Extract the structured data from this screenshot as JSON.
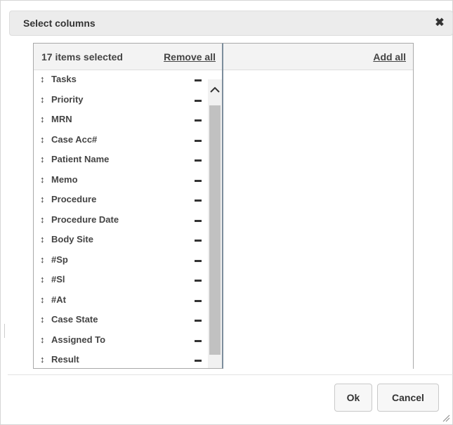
{
  "dialog": {
    "title": "Select columns",
    "close_icon": "close-icon",
    "close_glyph": "✖"
  },
  "selected_panel": {
    "count_label": "17 items selected",
    "remove_all_label": "Remove all",
    "drag_glyph": "↕",
    "items": [
      {
        "label": "Tasks"
      },
      {
        "label": "Priority"
      },
      {
        "label": "MRN"
      },
      {
        "label": "Case Acc#"
      },
      {
        "label": "Patient Name"
      },
      {
        "label": "Memo"
      },
      {
        "label": "Procedure"
      },
      {
        "label": "Procedure Date"
      },
      {
        "label": "Body Site"
      },
      {
        "label": "#Sp"
      },
      {
        "label": "#Sl"
      },
      {
        "label": "#At"
      },
      {
        "label": "Case State"
      },
      {
        "label": "Assigned To"
      },
      {
        "label": "Result"
      }
    ]
  },
  "available_panel": {
    "add_all_label": "Add all",
    "items": []
  },
  "footer": {
    "ok_label": "Ok",
    "cancel_label": "Cancel"
  },
  "colors": {
    "titlebar_bg": "#ececec",
    "header_bg": "#f3f3f3",
    "scroll_thumb": "#c1c1c1",
    "divider": "#7c8d9c"
  }
}
